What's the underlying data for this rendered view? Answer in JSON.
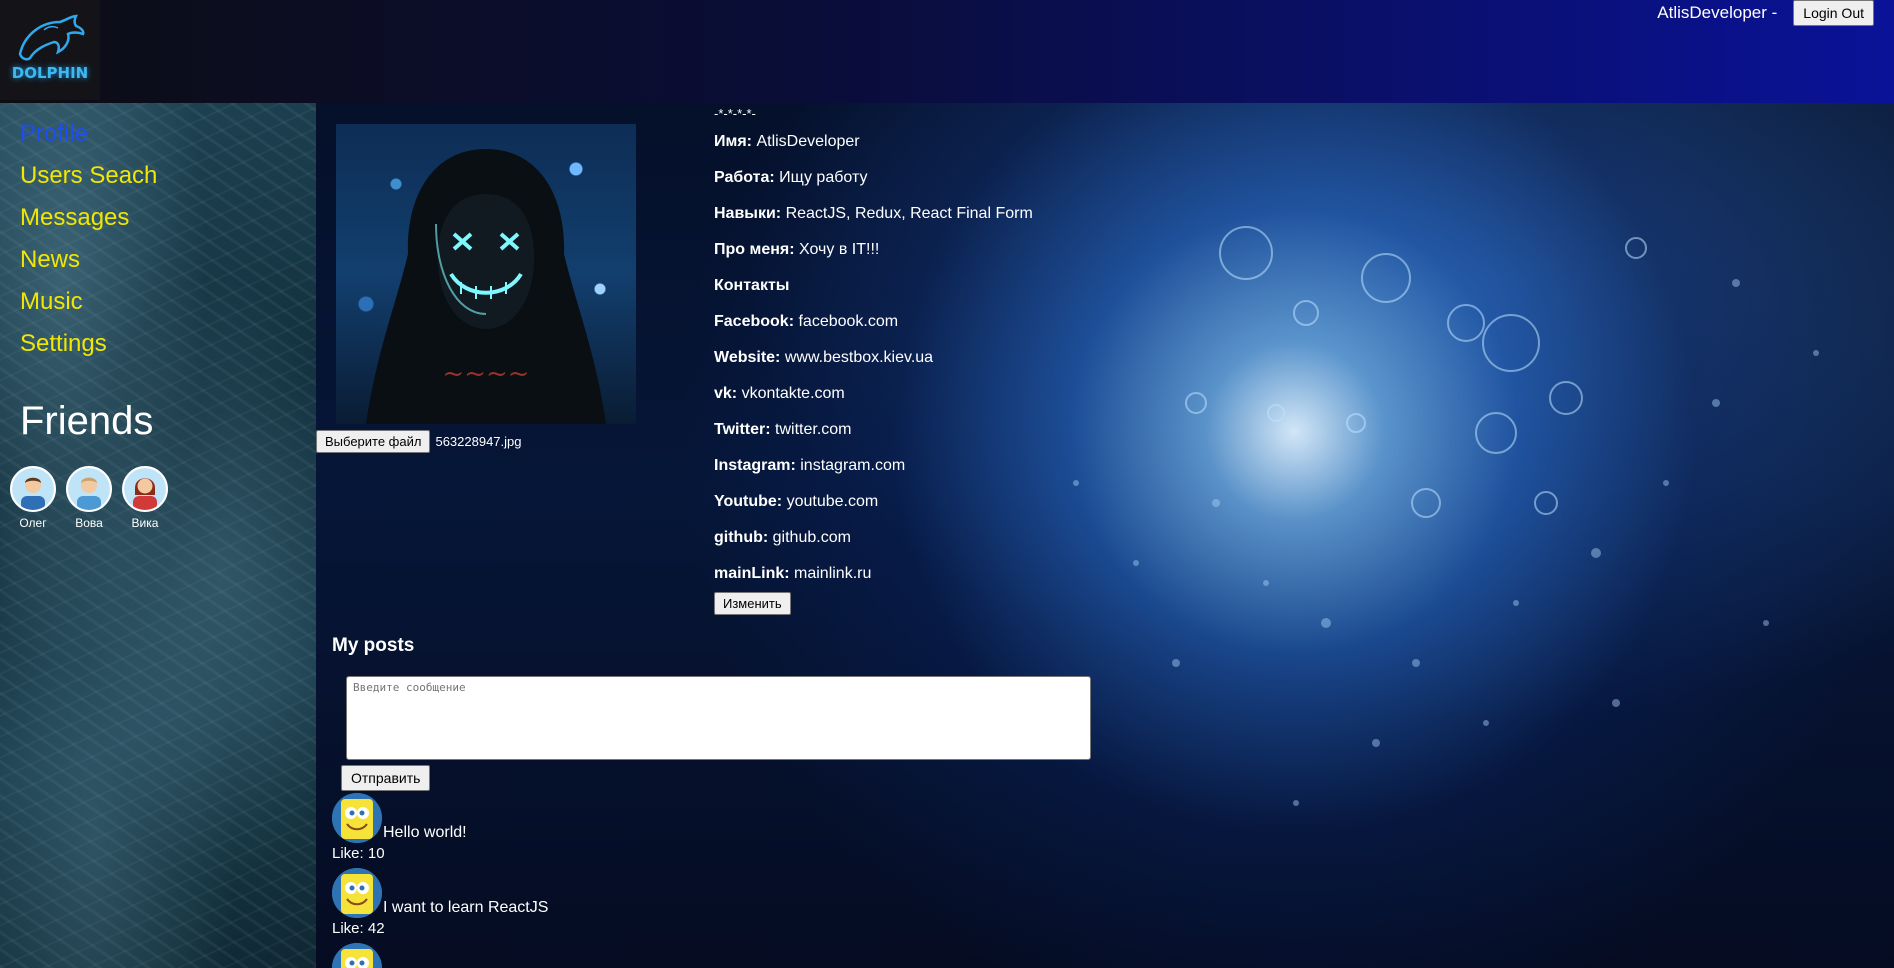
{
  "header": {
    "logo_text": "DOLPHIN",
    "user_name": "AtlisDeveloper -",
    "logout_label": "Login Out"
  },
  "sidebar": {
    "nav": [
      {
        "label": "Profile",
        "active": true
      },
      {
        "label": "Users Seach",
        "active": false
      },
      {
        "label": "Messages",
        "active": false
      },
      {
        "label": "News",
        "active": false
      },
      {
        "label": "Music",
        "active": false
      },
      {
        "label": "Settings",
        "active": false
      }
    ],
    "friends_title": "Friends",
    "friends": [
      {
        "name": "Олег"
      },
      {
        "name": "Вова"
      },
      {
        "name": "Вика"
      }
    ]
  },
  "profile": {
    "file_button": "Выберите файл",
    "file_name": "563228947.jpg",
    "status": "-*-*-*-*-",
    "fields": [
      {
        "label": "Имя:",
        "value": "AtlisDeveloper"
      },
      {
        "label": "Работа:",
        "value": "Ищу работу"
      },
      {
        "label": "Навыки:",
        "value": "ReactJS, Redux, React Final Form"
      },
      {
        "label": "Про меня:",
        "value": "Хочу в IT!!!"
      },
      {
        "label": "Контакты",
        "value": ""
      },
      {
        "label": "Facebook:",
        "value": "facebook.com"
      },
      {
        "label": "Website:",
        "value": "www.bestbox.kiev.ua"
      },
      {
        "label": "vk:",
        "value": "vkontakte.com"
      },
      {
        "label": "Twitter:",
        "value": "twitter.com"
      },
      {
        "label": "Instagram:",
        "value": "instagram.com"
      },
      {
        "label": "Youtube:",
        "value": "youtube.com"
      },
      {
        "label": "github:",
        "value": "github.com"
      },
      {
        "label": "mainLink:",
        "value": "mainlink.ru"
      }
    ],
    "edit_label": "Изменить"
  },
  "posts": {
    "title": "My posts",
    "placeholder": "Введите сообщение",
    "send_label": "Отправить",
    "items": [
      {
        "text": "Hello world!",
        "likes": "Like: 10"
      },
      {
        "text": "I want to learn ReactJS",
        "likes": "Like: 42"
      },
      {
        "text": "",
        "likes": ""
      }
    ]
  },
  "colors": {
    "nav_link": "#f1e700",
    "nav_active": "#1d4ef0",
    "header_gradient_end": "#0a1298"
  }
}
